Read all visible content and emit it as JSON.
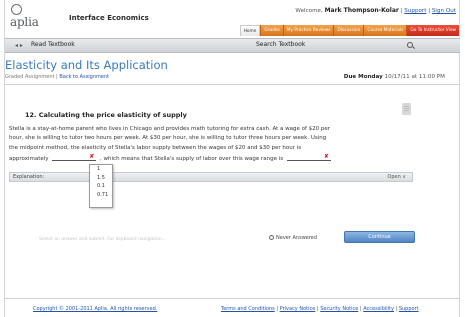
{
  "header": {
    "logo_text": "aplia",
    "course_title": "Interface Economics",
    "welcome_prefix": "Welcome,",
    "user_name": "Mark Thompson-Kolar",
    "support_label": "Support",
    "signout_label": "Sign Out",
    "separator": "|",
    "tabs": [
      {
        "label": "Home"
      },
      {
        "label": "Grades"
      },
      {
        "label": "My Practice Reviews"
      },
      {
        "label": "Discussion"
      },
      {
        "label": "Course Materials"
      },
      {
        "label": "Go To Instructor View"
      }
    ]
  },
  "toolbar": {
    "arrow": "◂ ▸",
    "read_textbook": "Read Textbook",
    "search_textbook": "Search Textbook"
  },
  "page": {
    "title": "Elasticity and Its Application",
    "assignment_type": "Graded Assignment",
    "back_link": "Back to Assignment",
    "due_label": "Due Monday",
    "due_time": "10/17/11 at 11:00 PM"
  },
  "question": {
    "number_title": "12.  Calculating the price elasticity of supply",
    "lines": [
      "Stella is a stay-at-home parent who lives in Chicago and provides math tutoring for extra cash. At a wage of $20 per",
      "hour, she is willing to tutor two hours per week. At $30 per hour, she is willing to tutor three hours per week. Using",
      "the midpoint method, the elasticity of Stella's labor supply between the wages of $20 and $30 per hour is"
    ],
    "line4_prefix": "approximately",
    "line4_middle": ", which means that Stella's supply of labor over this wage range is",
    "mark": "✘",
    "dropdown_options": [
      "1",
      "1.5",
      "0.1",
      "0.71"
    ]
  },
  "explanation": {
    "label": "Explanation:",
    "open_label": "Open ∨"
  },
  "actions": {
    "faint_text": "Select an answer and submit. For keyboard navigation...",
    "never_answered": "Never Answered",
    "continue_label": "Continue"
  },
  "footer": {
    "copyright": "Copyright © 2001-2011 Aplia. All rights reserved.",
    "terms": "Terms and Conditions",
    "privacy": "Privacy Notice",
    "security": "Security Notice",
    "accessibility": "Accessibility",
    "support": "Support",
    "separator": "|"
  }
}
